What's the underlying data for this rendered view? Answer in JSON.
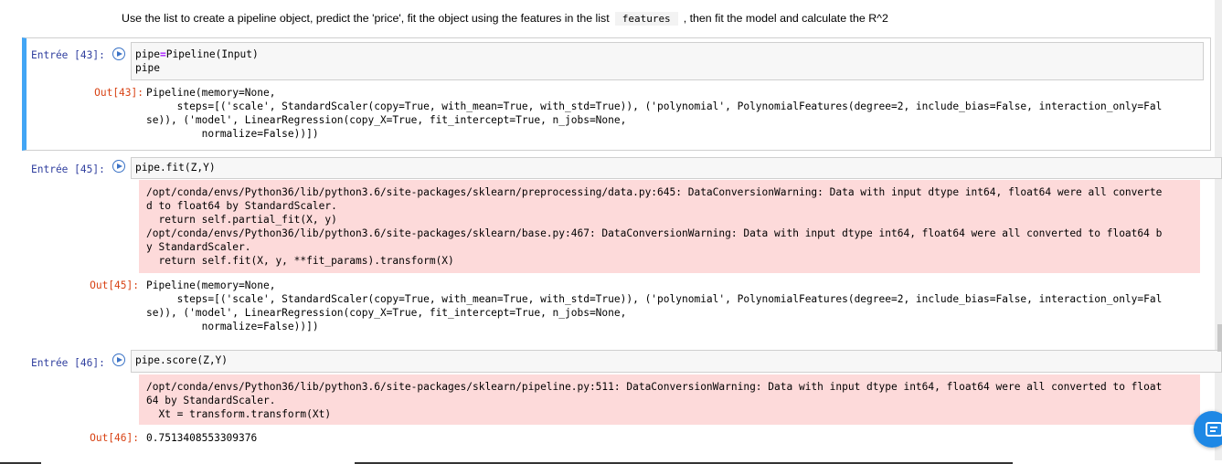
{
  "markdown": {
    "before": "Use the list to create a pipeline object, predict the 'price', fit the object using the features in the list",
    "code": "features",
    "after": ", then fit the model and calculate the R^2"
  },
  "cells": [
    {
      "in_prompt": "Entrée [43]:",
      "code_line1_a": "pipe",
      "code_line1_eq": "=",
      "code_line1_b": "Pipeline(Input)",
      "code_line2": "pipe",
      "out_prompt": "Out[43]:",
      "output": "Pipeline(memory=None,\n     steps=[('scale', StandardScaler(copy=True, with_mean=True, with_std=True)), ('polynomial', PolynomialFeatures(degree=2, include_bias=False, interaction_only=Fal\nse)), ('model', LinearRegression(copy_X=True, fit_intercept=True, n_jobs=None,\n         normalize=False))])"
    },
    {
      "in_prompt": "Entrée [45]:",
      "code": "pipe.fit(Z,Y)",
      "stderr": "/opt/conda/envs/Python36/lib/python3.6/site-packages/sklearn/preprocessing/data.py:645: DataConversionWarning: Data with input dtype int64, float64 were all converte\nd to float64 by StandardScaler.\n  return self.partial_fit(X, y)\n/opt/conda/envs/Python36/lib/python3.6/site-packages/sklearn/base.py:467: DataConversionWarning: Data with input dtype int64, float64 were all converted to float64 b\ny StandardScaler.\n  return self.fit(X, y, **fit_params).transform(X)",
      "out_prompt": "Out[45]:",
      "output": "Pipeline(memory=None,\n     steps=[('scale', StandardScaler(copy=True, with_mean=True, with_std=True)), ('polynomial', PolynomialFeatures(degree=2, include_bias=False, interaction_only=Fal\nse)), ('model', LinearRegression(copy_X=True, fit_intercept=True, n_jobs=None,\n         normalize=False))])"
    },
    {
      "in_prompt": "Entrée [46]:",
      "code": "pipe.score(Z,Y)",
      "stderr": "/opt/conda/envs/Python36/lib/python3.6/site-packages/sklearn/pipeline.py:511: DataConversionWarning: Data with input dtype int64, float64 were all converted to float\n64 by StandardScaler.\n  Xt = transform.transform(Xt)",
      "out_prompt": "Out[46]:",
      "output": "0.7513408553309376"
    }
  ],
  "colors": {
    "selected_border": "#42a5f5",
    "stderr_bg": "#fddada",
    "in_prompt": "#303f9f",
    "out_prompt": "#d84315"
  },
  "icons": {
    "run": "run-cell-icon",
    "chat": "chat-icon"
  }
}
